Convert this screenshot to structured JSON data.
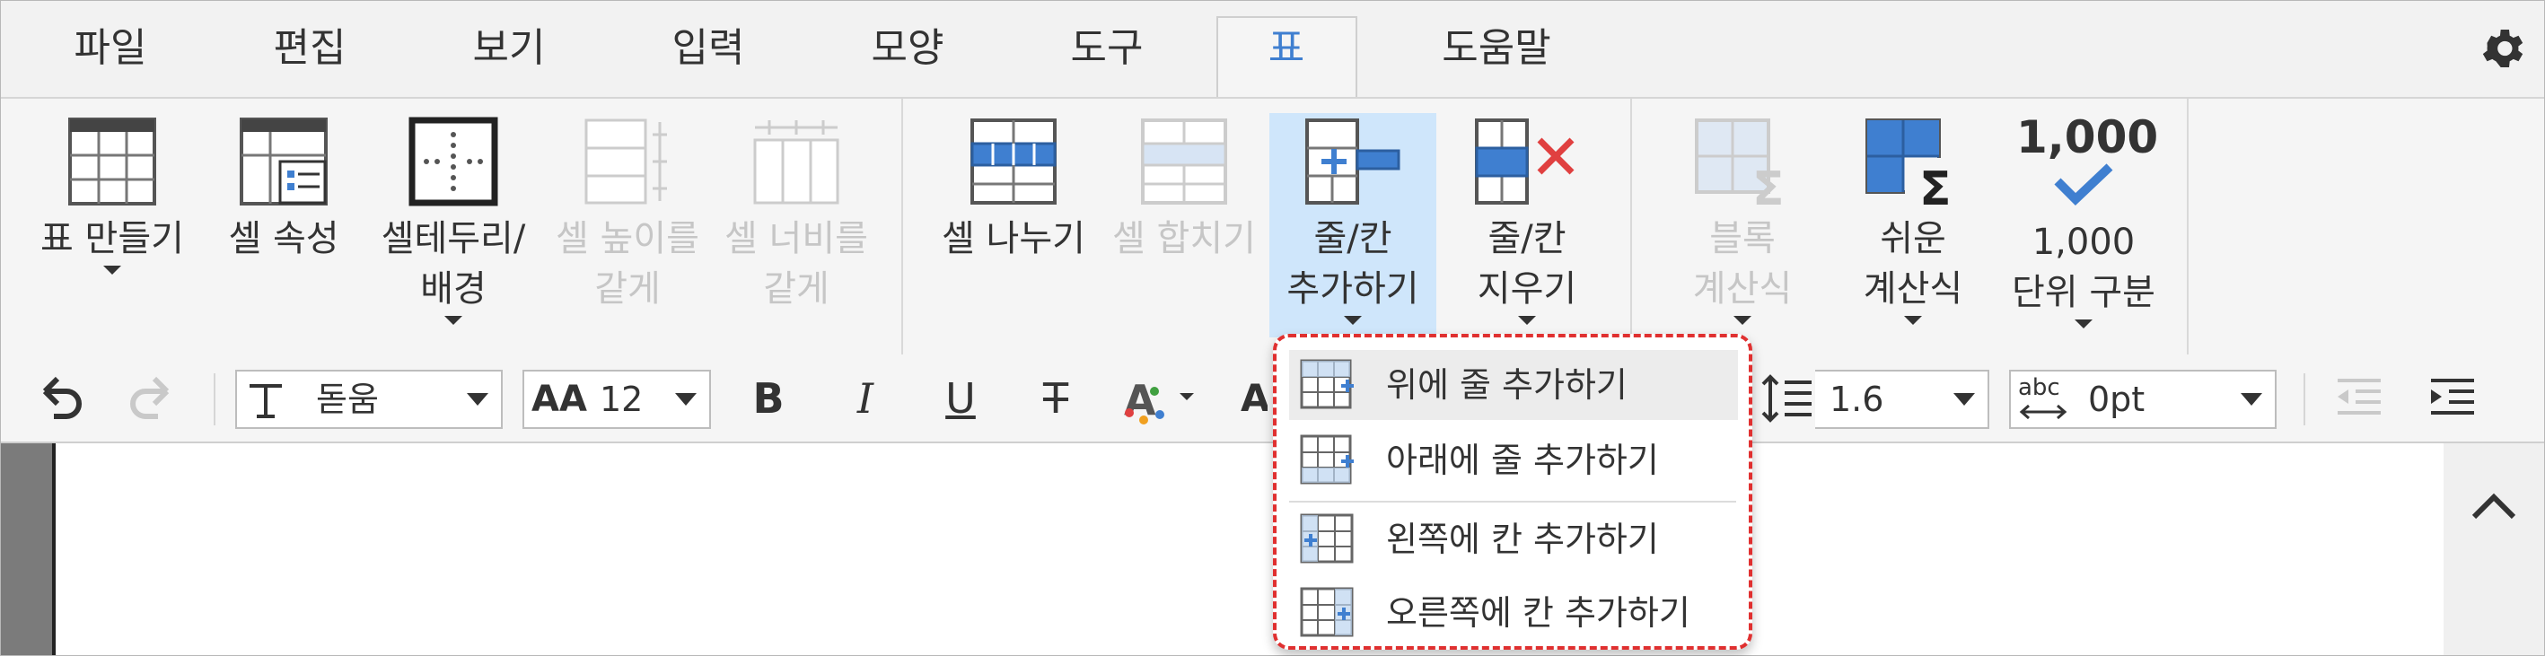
{
  "tabs": [
    {
      "label": "파일"
    },
    {
      "label": "편집"
    },
    {
      "label": "보기"
    },
    {
      "label": "입력"
    },
    {
      "label": "모양"
    },
    {
      "label": "도구"
    },
    {
      "label": "표",
      "active": true
    },
    {
      "label": "도움말"
    }
  ],
  "ribbon": {
    "make_table": "표 만들기",
    "cell_props": "셀 속성",
    "cell_border_1": "셀테두리/",
    "cell_border_2": "배경",
    "cell_height_1": "셀 높이를",
    "cell_height_2": "같게",
    "cell_width_1": "셀 너비를",
    "cell_width_2": "같게",
    "split_cell": "셀 나누기",
    "merge_cell": "셀 합치기",
    "add_rowcol_1": "줄/칸",
    "add_rowcol_2": "추가하기",
    "del_rowcol_1": "줄/칸",
    "del_rowcol_2": "지우기",
    "block_calc_1": "블록",
    "block_calc_2": "계산식",
    "easy_calc_1": "쉬운",
    "easy_calc_2": "계산식",
    "thousand_icon_text": "1,000",
    "thousand_1": "1,000",
    "thousand_2": "단위 구분"
  },
  "toolbar": {
    "font_name": "돋움",
    "font_size": "12",
    "font_size_icon": "AA",
    "bold": "B",
    "italic": "I",
    "underline": "U",
    "strike": "T",
    "line_spacing": "1.6",
    "char_spacing_icon": "abc",
    "char_spacing": "0pt",
    "partial_char": "A"
  },
  "menu": {
    "items": [
      {
        "label": "위에 줄 추가하기",
        "highlighted": true
      },
      {
        "label": "아래에 줄 추가하기"
      },
      {
        "label": "왼쪽에 칸 추가하기"
      },
      {
        "label": "오른쪽에 칸 추가하기"
      }
    ]
  },
  "colors": {
    "accent": "#3f7fd0",
    "selected_bg": "#cfe6fb",
    "menu_outline": "#e03030",
    "delete_red": "#e04040"
  }
}
